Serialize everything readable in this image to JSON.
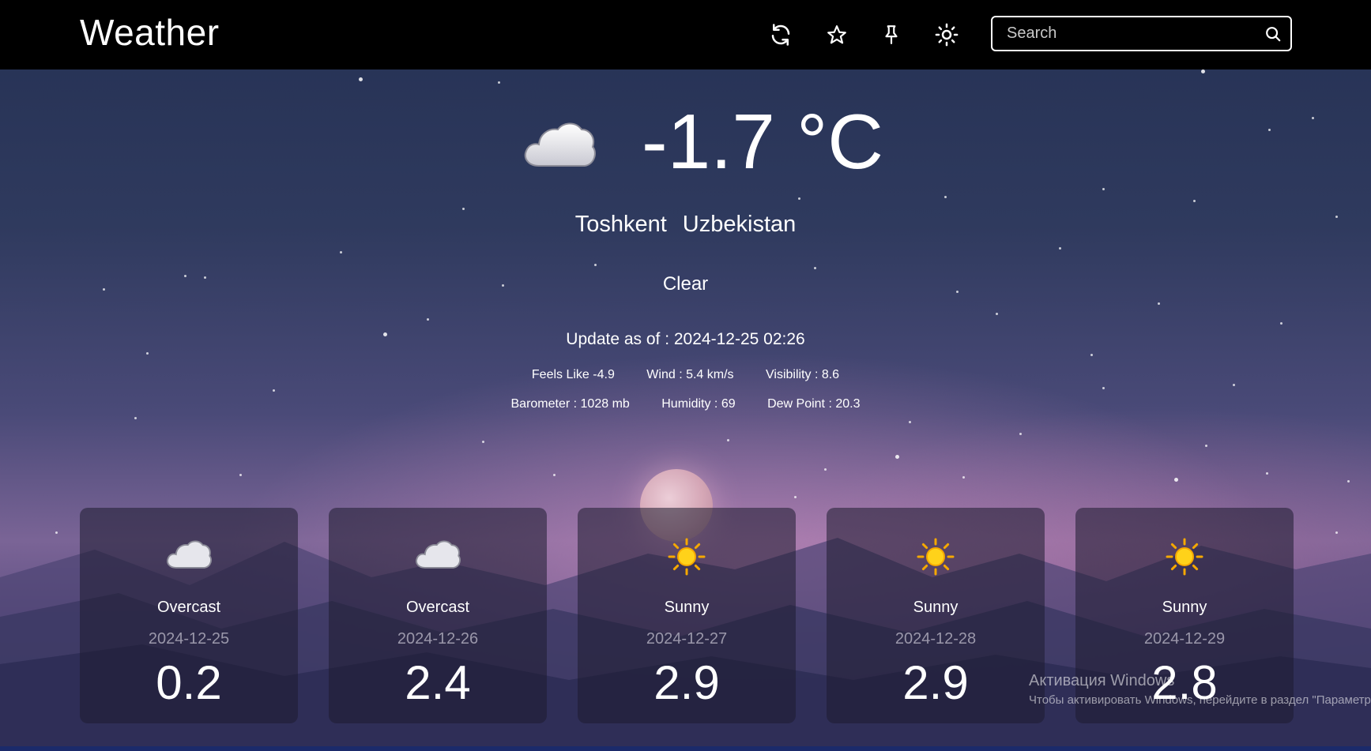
{
  "header": {
    "title": "Weather",
    "icons": {
      "refresh": "refresh-icon",
      "favorite": "star-icon",
      "pin": "pin-icon",
      "theme": "sun-icon",
      "search": "search-icon"
    },
    "search_placeholder": "Search"
  },
  "current": {
    "icon": "cloud-icon",
    "temperature": "-1.7 °C",
    "city": "Toshkent",
    "country": "Uzbekistan",
    "condition": "Clear",
    "updated": "Update as of : 2024-12-25 02:26",
    "details_row1": [
      "Feels Like -4.9",
      "Wind : 5.4 km/s",
      "Visibility : 8.6"
    ],
    "details_row2": [
      "Barometer : 1028 mb",
      "Humidity : 69",
      "Dew Point : 20.3"
    ]
  },
  "forecast": [
    {
      "icon": "cloud-icon",
      "condition": "Overcast",
      "date": "2024-12-25",
      "value": "0.2"
    },
    {
      "icon": "cloud-icon",
      "condition": "Overcast",
      "date": "2024-12-26",
      "value": "2.4"
    },
    {
      "icon": "sun-icon",
      "condition": "Sunny",
      "date": "2024-12-27",
      "value": "2.9"
    },
    {
      "icon": "sun-icon",
      "condition": "Sunny",
      "date": "2024-12-28",
      "value": "2.9"
    },
    {
      "icon": "sun-icon",
      "condition": "Sunny",
      "date": "2024-12-29",
      "value": "2.8"
    }
  ],
  "watermark": {
    "title": "Активация Windows",
    "subtitle": "Чтобы активировать Windows, перейдите в раздел \"Параметры\"."
  },
  "colors": {
    "header_bg": "#000000",
    "card_bg": "#1e1c30",
    "sun_yellow": "#ffcc00",
    "date_gray": "#9a97aa"
  }
}
